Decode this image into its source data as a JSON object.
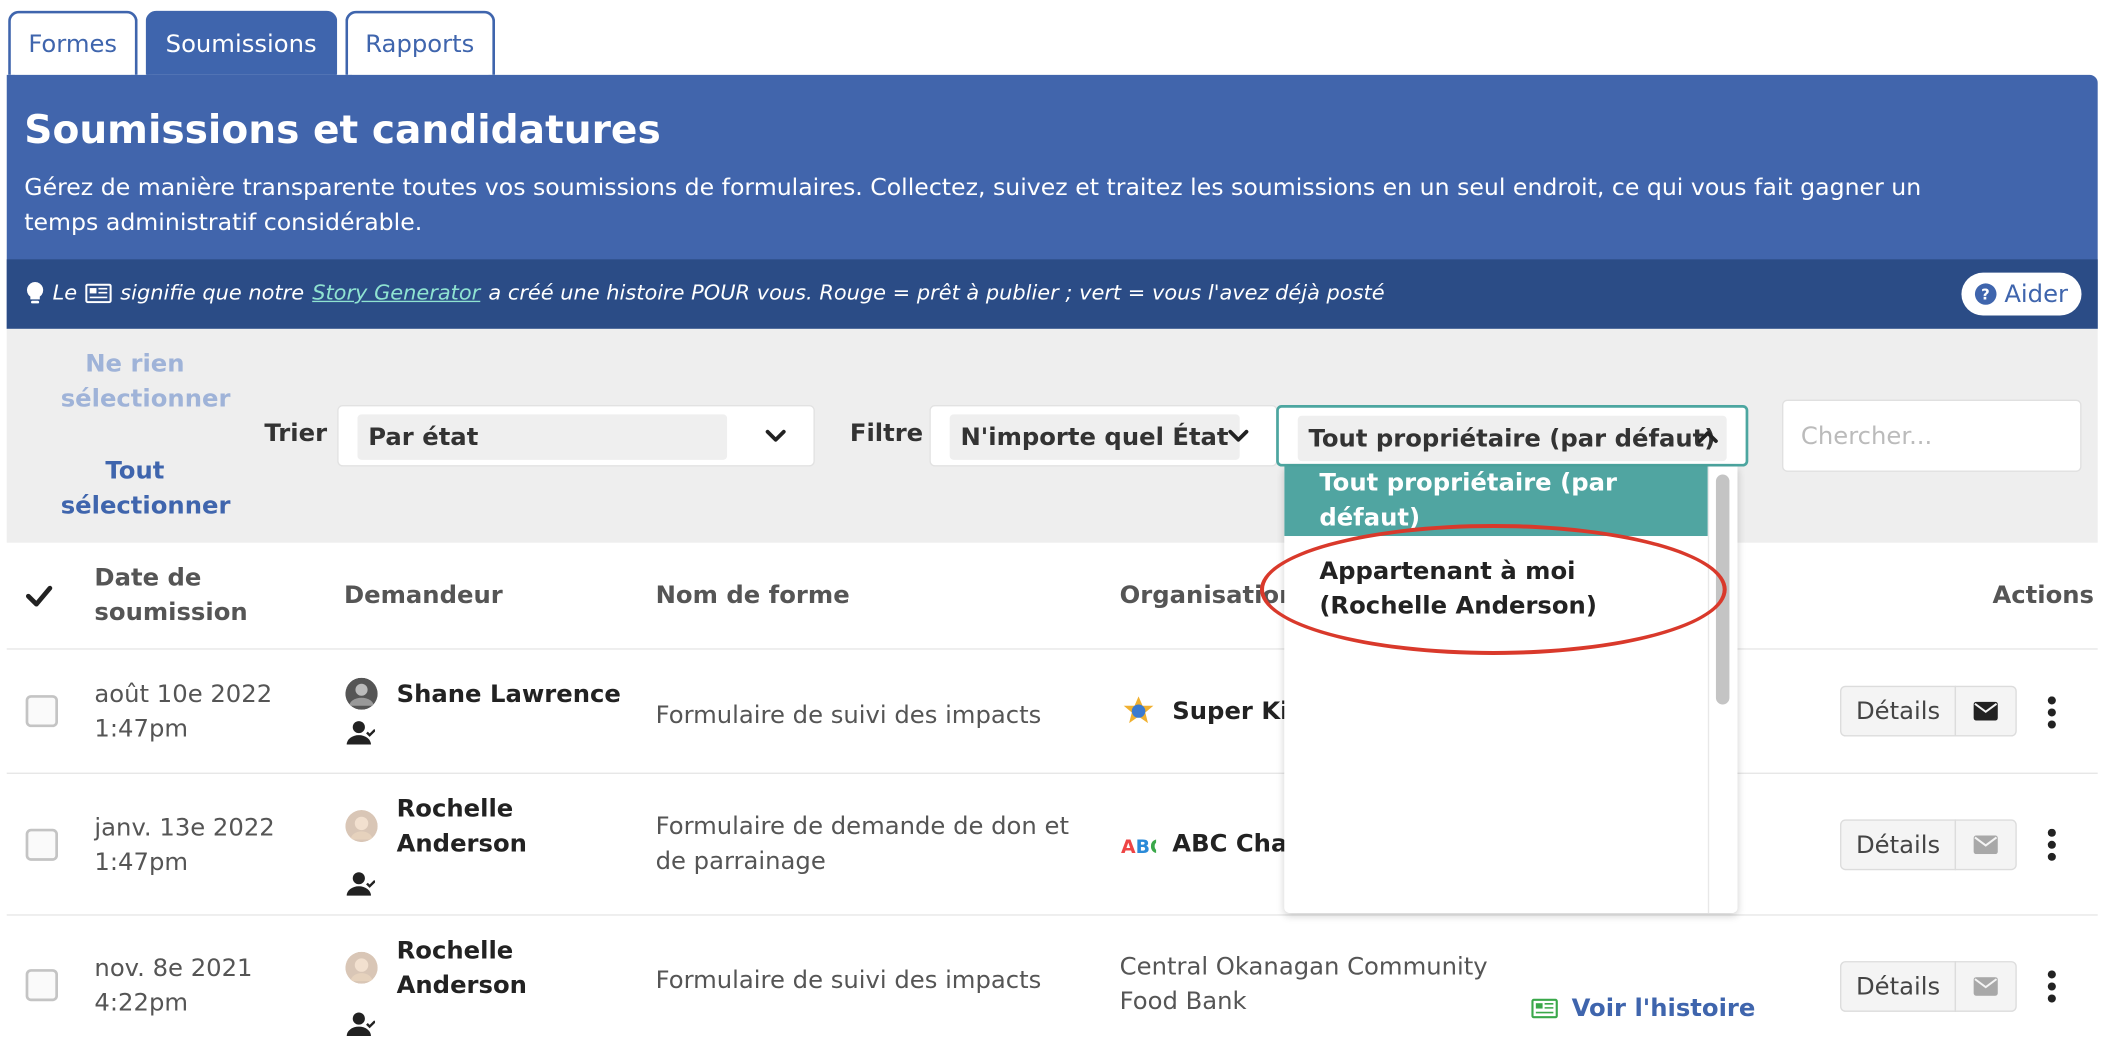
{
  "tabs": [
    {
      "label": "Formes",
      "active": false
    },
    {
      "label": "Soumissions",
      "active": true
    },
    {
      "label": "Rapports",
      "active": false
    }
  ],
  "header": {
    "title": "Soumissions et candidatures",
    "description": "Gérez de manière transparente toutes vos soumissions de formulaires. Collectez, suivez et traitez les soumissions en un seul endroit, ce qui vous fait gagner un temps administratif considérable."
  },
  "notebar": {
    "prefix": "Le",
    "middle": "signifie que notre",
    "link": "Story Generator",
    "suffix": "a créé une histoire POUR vous. Rouge = prêt à publier ; vert = vous l'avez déjà posté",
    "help_label": "Aider"
  },
  "toolbar": {
    "select_none": "Ne rien sélectionner",
    "select_all": "Tout sélectionner",
    "sort_label": "Trier",
    "sort_value": "Par état",
    "filter_label": "Filtre",
    "filter_value": "N'importe quel État",
    "owner_value": "Tout propriétaire (par défaut)",
    "search_placeholder": "Chercher..."
  },
  "owner_dropdown": {
    "options": [
      "Tout propriétaire (par défaut)",
      "Appartenant à moi (Rochelle Anderson)"
    ],
    "selected": "Tout propriétaire (par défaut)"
  },
  "table": {
    "headers": {
      "date": "Date de soumission",
      "applicant": "Demandeur",
      "form": "Nom de forme",
      "org": "Organisation a",
      "actions": "Actions"
    },
    "rows": [
      {
        "date": "août 10e 2022",
        "time": "1:47pm",
        "applicant": "Shane Lawrence",
        "form": "Formulaire de suivi des impacts",
        "org": "Super Kid",
        "details": "Détails"
      },
      {
        "date": "janv. 13e 2022",
        "time": "1:47pm",
        "applicant_first": "Rochelle",
        "applicant_last": "Anderson",
        "form_line1": "Formulaire de demande de don et",
        "form_line2": "de parrainage",
        "org": "ABC Chari",
        "details": "Détails"
      },
      {
        "date": "nov. 8e 2021",
        "time": "4:22pm",
        "applicant_first": "Rochelle",
        "applicant_last": "Anderson",
        "form": "Formulaire de suivi des impacts",
        "org_line1": "Central Okanagan Community",
        "org_line2": "Food Bank",
        "story_link": "Voir l'histoire",
        "details": "Détails"
      }
    ]
  },
  "colors": {
    "brand": "#4165ac",
    "notebar": "#2b4c86",
    "teal": "#50a5a1",
    "highlight": "#d9392b"
  }
}
